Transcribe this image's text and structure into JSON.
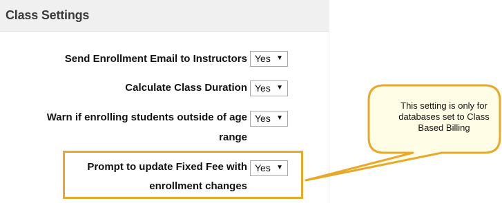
{
  "panel": {
    "title": "Class Settings"
  },
  "settings": [
    {
      "label": "Send Enrollment Email to Instructors",
      "value": "Yes"
    },
    {
      "label": "Calculate Class Duration",
      "value": "Yes"
    },
    {
      "label_line1": "Warn if enrolling students outside of age",
      "label_line2": "range",
      "value": "Yes"
    },
    {
      "label_line1": "Prompt to update Fixed Fee with",
      "label_line2": "enrollment changes",
      "value": "Yes"
    }
  ],
  "dropdown_arrow": "▼",
  "callout": {
    "line1": "This setting is only for",
    "line2": "databases set to Class",
    "line3": "Based Billing"
  },
  "colors": {
    "highlight": "#e8a92a",
    "callout_fill": "#fffde6",
    "header_bg": "#f0f0f0"
  }
}
